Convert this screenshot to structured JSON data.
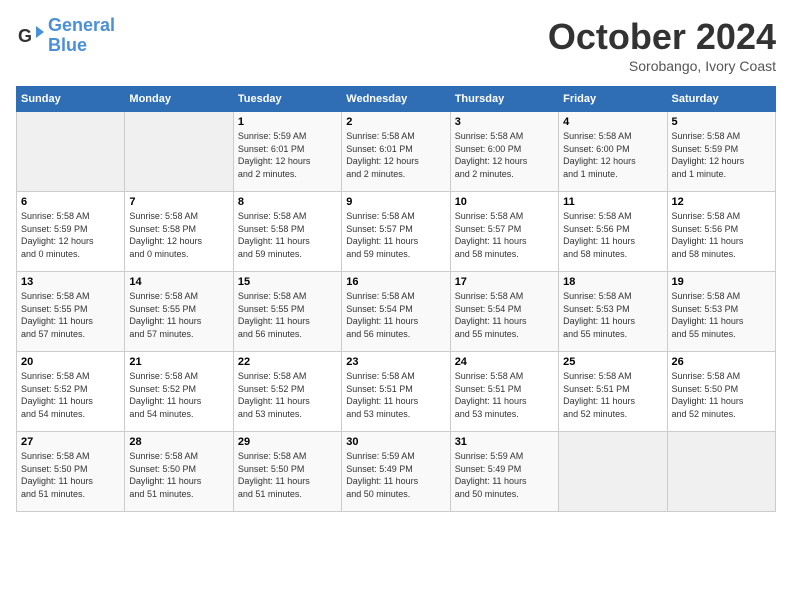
{
  "header": {
    "logo": {
      "line1": "General",
      "line2": "Blue"
    },
    "month": "October 2024",
    "location": "Sorobango, Ivory Coast"
  },
  "weekdays": [
    "Sunday",
    "Monday",
    "Tuesday",
    "Wednesday",
    "Thursday",
    "Friday",
    "Saturday"
  ],
  "weeks": [
    [
      {
        "day": "",
        "info": ""
      },
      {
        "day": "",
        "info": ""
      },
      {
        "day": "1",
        "info": "Sunrise: 5:59 AM\nSunset: 6:01 PM\nDaylight: 12 hours\nand 2 minutes."
      },
      {
        "day": "2",
        "info": "Sunrise: 5:58 AM\nSunset: 6:01 PM\nDaylight: 12 hours\nand 2 minutes."
      },
      {
        "day": "3",
        "info": "Sunrise: 5:58 AM\nSunset: 6:00 PM\nDaylight: 12 hours\nand 2 minutes."
      },
      {
        "day": "4",
        "info": "Sunrise: 5:58 AM\nSunset: 6:00 PM\nDaylight: 12 hours\nand 1 minute."
      },
      {
        "day": "5",
        "info": "Sunrise: 5:58 AM\nSunset: 5:59 PM\nDaylight: 12 hours\nand 1 minute."
      }
    ],
    [
      {
        "day": "6",
        "info": "Sunrise: 5:58 AM\nSunset: 5:59 PM\nDaylight: 12 hours\nand 0 minutes."
      },
      {
        "day": "7",
        "info": "Sunrise: 5:58 AM\nSunset: 5:58 PM\nDaylight: 12 hours\nand 0 minutes."
      },
      {
        "day": "8",
        "info": "Sunrise: 5:58 AM\nSunset: 5:58 PM\nDaylight: 11 hours\nand 59 minutes."
      },
      {
        "day": "9",
        "info": "Sunrise: 5:58 AM\nSunset: 5:57 PM\nDaylight: 11 hours\nand 59 minutes."
      },
      {
        "day": "10",
        "info": "Sunrise: 5:58 AM\nSunset: 5:57 PM\nDaylight: 11 hours\nand 58 minutes."
      },
      {
        "day": "11",
        "info": "Sunrise: 5:58 AM\nSunset: 5:56 PM\nDaylight: 11 hours\nand 58 minutes."
      },
      {
        "day": "12",
        "info": "Sunrise: 5:58 AM\nSunset: 5:56 PM\nDaylight: 11 hours\nand 58 minutes."
      }
    ],
    [
      {
        "day": "13",
        "info": "Sunrise: 5:58 AM\nSunset: 5:55 PM\nDaylight: 11 hours\nand 57 minutes."
      },
      {
        "day": "14",
        "info": "Sunrise: 5:58 AM\nSunset: 5:55 PM\nDaylight: 11 hours\nand 57 minutes."
      },
      {
        "day": "15",
        "info": "Sunrise: 5:58 AM\nSunset: 5:55 PM\nDaylight: 11 hours\nand 56 minutes."
      },
      {
        "day": "16",
        "info": "Sunrise: 5:58 AM\nSunset: 5:54 PM\nDaylight: 11 hours\nand 56 minutes."
      },
      {
        "day": "17",
        "info": "Sunrise: 5:58 AM\nSunset: 5:54 PM\nDaylight: 11 hours\nand 55 minutes."
      },
      {
        "day": "18",
        "info": "Sunrise: 5:58 AM\nSunset: 5:53 PM\nDaylight: 11 hours\nand 55 minutes."
      },
      {
        "day": "19",
        "info": "Sunrise: 5:58 AM\nSunset: 5:53 PM\nDaylight: 11 hours\nand 55 minutes."
      }
    ],
    [
      {
        "day": "20",
        "info": "Sunrise: 5:58 AM\nSunset: 5:52 PM\nDaylight: 11 hours\nand 54 minutes."
      },
      {
        "day": "21",
        "info": "Sunrise: 5:58 AM\nSunset: 5:52 PM\nDaylight: 11 hours\nand 54 minutes."
      },
      {
        "day": "22",
        "info": "Sunrise: 5:58 AM\nSunset: 5:52 PM\nDaylight: 11 hours\nand 53 minutes."
      },
      {
        "day": "23",
        "info": "Sunrise: 5:58 AM\nSunset: 5:51 PM\nDaylight: 11 hours\nand 53 minutes."
      },
      {
        "day": "24",
        "info": "Sunrise: 5:58 AM\nSunset: 5:51 PM\nDaylight: 11 hours\nand 53 minutes."
      },
      {
        "day": "25",
        "info": "Sunrise: 5:58 AM\nSunset: 5:51 PM\nDaylight: 11 hours\nand 52 minutes."
      },
      {
        "day": "26",
        "info": "Sunrise: 5:58 AM\nSunset: 5:50 PM\nDaylight: 11 hours\nand 52 minutes."
      }
    ],
    [
      {
        "day": "27",
        "info": "Sunrise: 5:58 AM\nSunset: 5:50 PM\nDaylight: 11 hours\nand 51 minutes."
      },
      {
        "day": "28",
        "info": "Sunrise: 5:58 AM\nSunset: 5:50 PM\nDaylight: 11 hours\nand 51 minutes."
      },
      {
        "day": "29",
        "info": "Sunrise: 5:58 AM\nSunset: 5:50 PM\nDaylight: 11 hours\nand 51 minutes."
      },
      {
        "day": "30",
        "info": "Sunrise: 5:59 AM\nSunset: 5:49 PM\nDaylight: 11 hours\nand 50 minutes."
      },
      {
        "day": "31",
        "info": "Sunrise: 5:59 AM\nSunset: 5:49 PM\nDaylight: 11 hours\nand 50 minutes."
      },
      {
        "day": "",
        "info": ""
      },
      {
        "day": "",
        "info": ""
      }
    ]
  ]
}
